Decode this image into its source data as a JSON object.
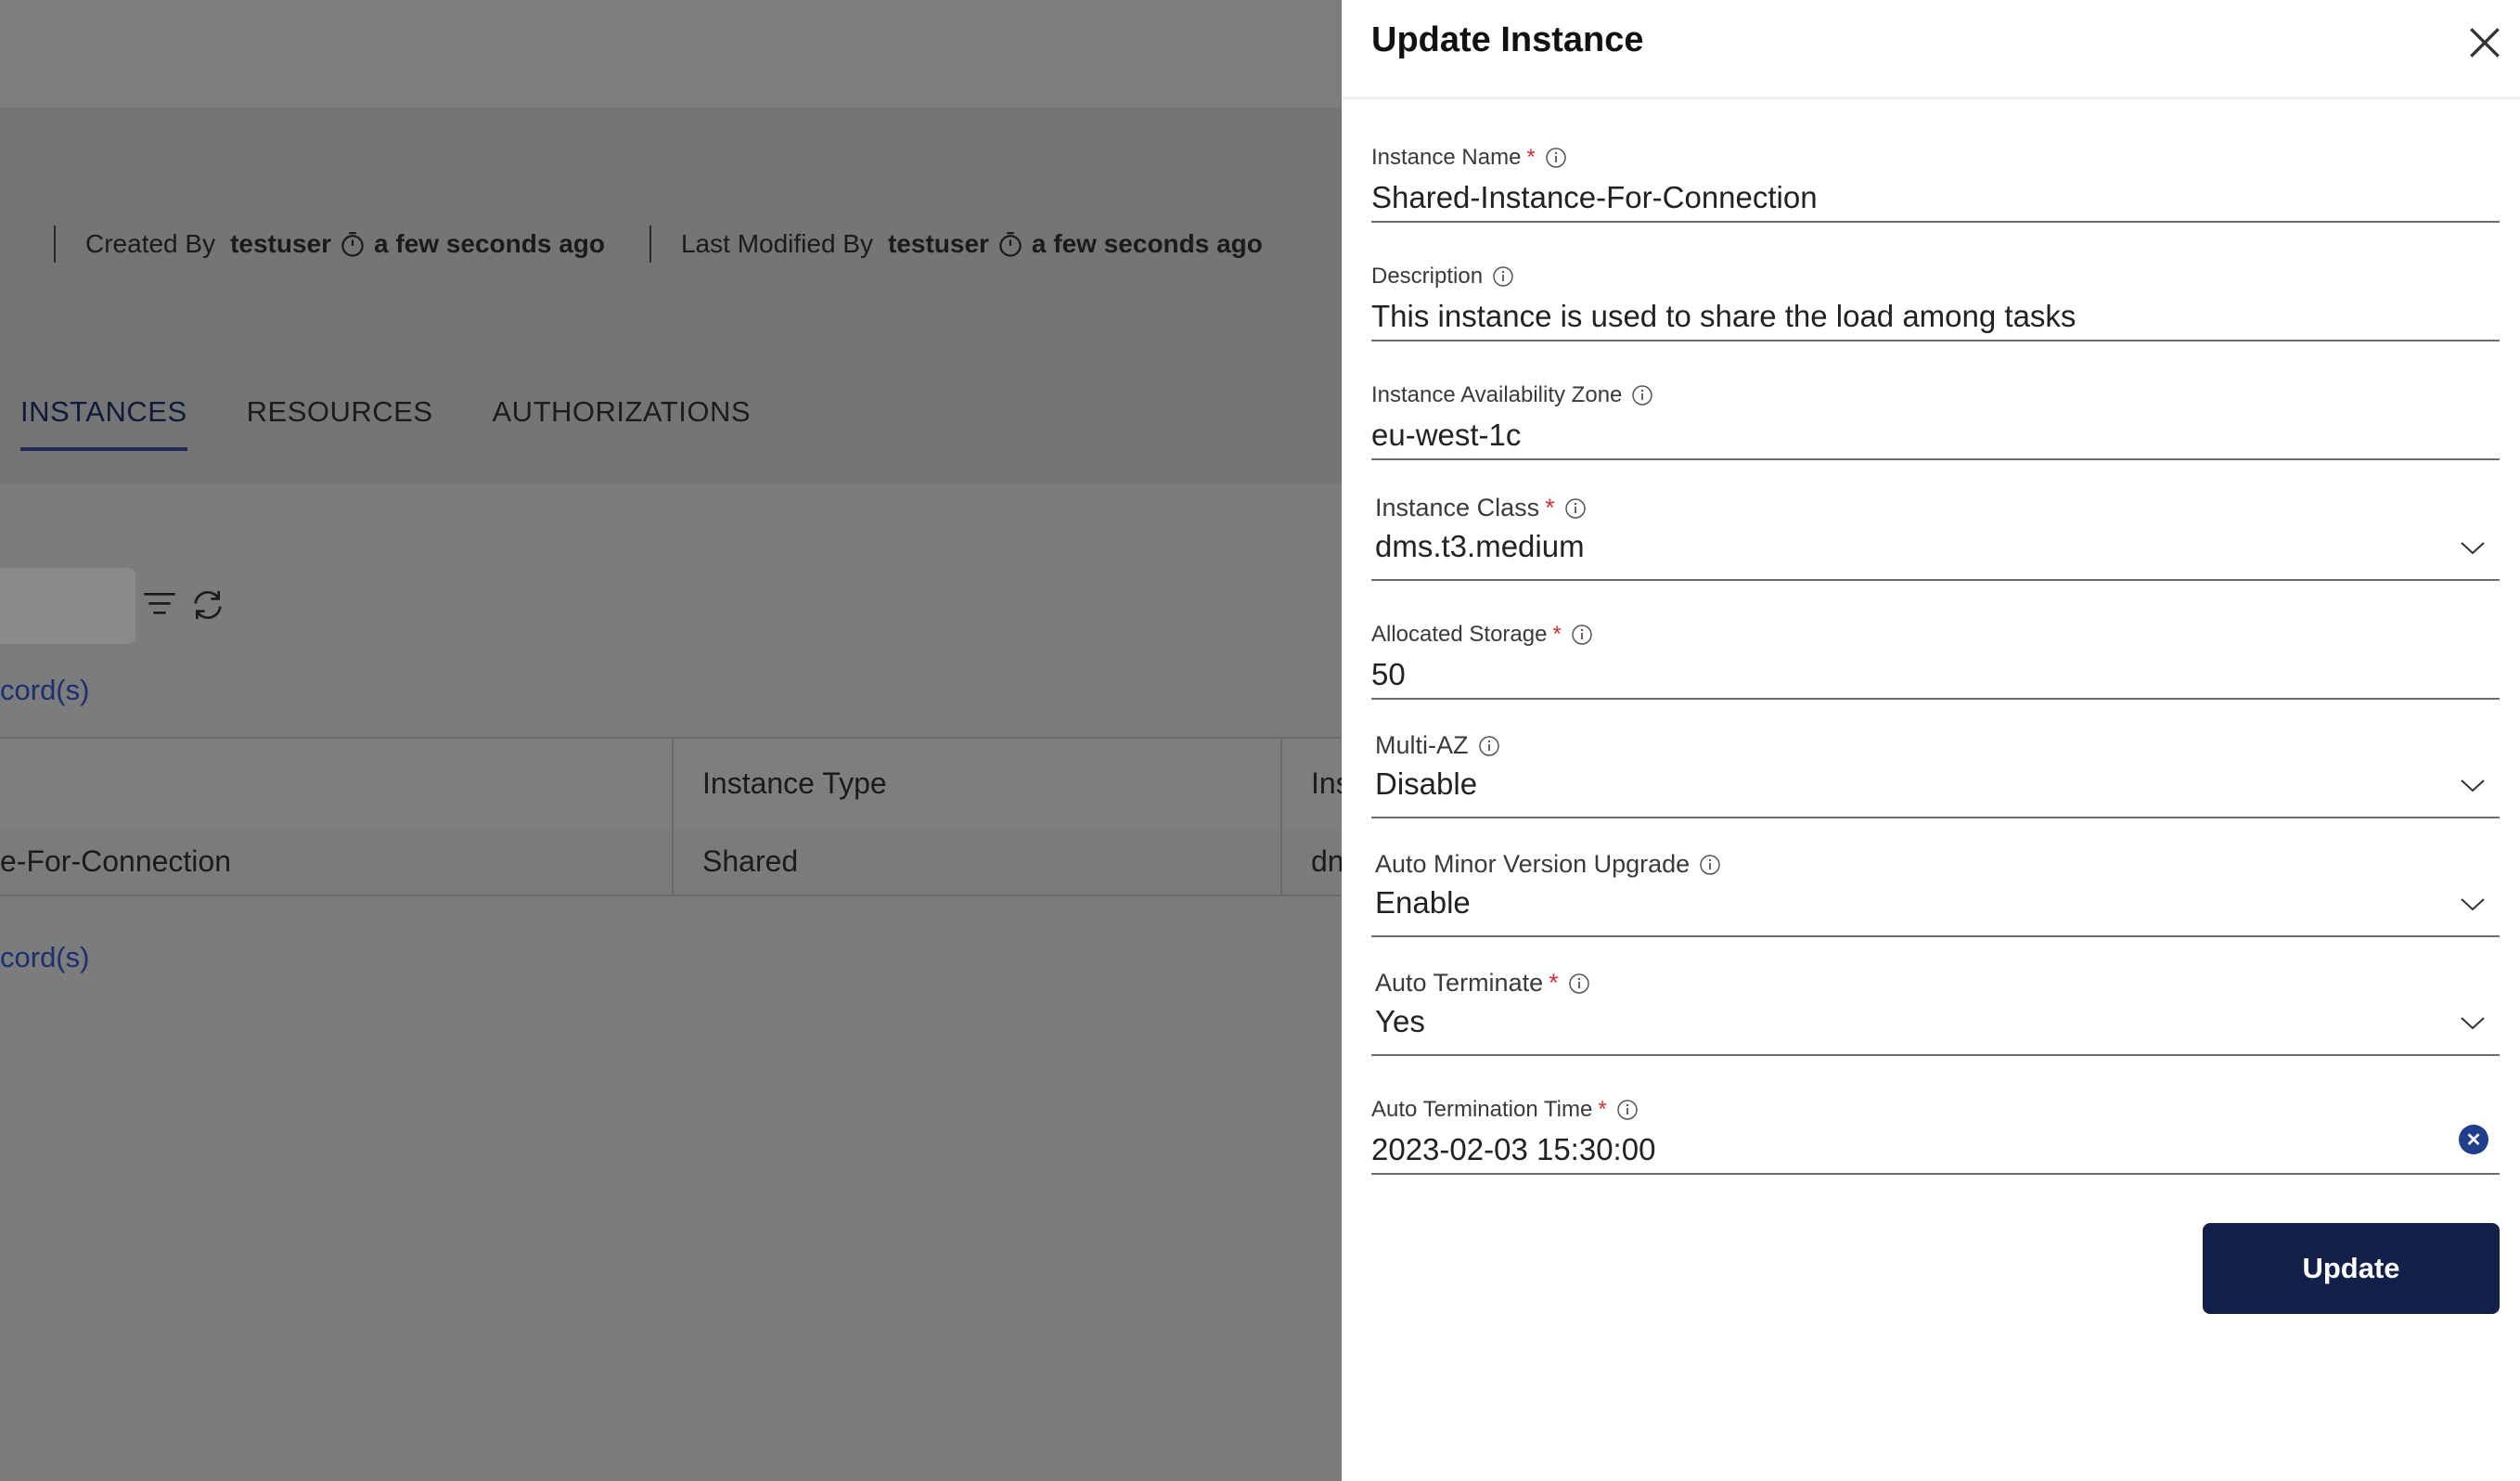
{
  "background": {
    "meta": {
      "created_label": "Created By",
      "created_user": "testuser",
      "created_time": "a few seconds ago",
      "modified_label": "Last Modified By",
      "modified_user": "testuser",
      "modified_time": "a few seconds ago"
    },
    "tabs": [
      "INSTANCES",
      "RESOURCES",
      "AUTHORIZATIONS"
    ],
    "records_top": "cord(s)",
    "records_bottom": "cord(s)",
    "grid": {
      "headers": [
        "Instance Type",
        "Ins"
      ],
      "row": [
        "e-For-Connection",
        "Shared",
        "dn"
      ]
    }
  },
  "drawer": {
    "title": "Update Instance",
    "fields": {
      "instance_name": {
        "label": "Instance Name",
        "value": "Shared-Instance-For-Connection",
        "required": "*"
      },
      "description": {
        "label": "Description",
        "value": "This instance is used to share the load among tasks"
      },
      "availability_zone": {
        "label": "Instance Availability Zone",
        "value": "eu-west-1c"
      },
      "instance_class": {
        "label": "Instance Class",
        "value": "dms.t3.medium",
        "required": "*"
      },
      "allocated_storage": {
        "label": "Allocated Storage",
        "value": "50",
        "required": "*"
      },
      "multi_az": {
        "label": "Multi-AZ",
        "value": "Disable"
      },
      "auto_minor_upgrade": {
        "label": "Auto Minor Version Upgrade",
        "value": "Enable"
      },
      "auto_terminate": {
        "label": "Auto Terminate",
        "value": "Yes",
        "required": "*"
      },
      "auto_termination_time": {
        "label": "Auto Termination Time",
        "value": "2023-02-03 15:30:00",
        "required": "*"
      }
    },
    "update_label": "Update"
  },
  "colors": {
    "overlay": "#7b7b7b",
    "primary": "#13204a",
    "required": "#d32f2f",
    "clear": "#1f3f8c",
    "link": "#1b2f72"
  }
}
